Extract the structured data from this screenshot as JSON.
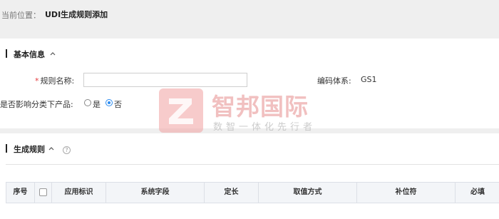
{
  "breadcrumb": {
    "prefix": "当前位置：",
    "title": "UDI生成规则添加"
  },
  "basic_info": {
    "title": "基本信息",
    "rule_name": {
      "required_mark": "*",
      "label": "规则名称:",
      "value": "",
      "placeholder": ""
    },
    "coding_system": {
      "label": "编码体系:",
      "value": "GS1"
    },
    "affects_products": {
      "label": "是否影响分类下产品:",
      "options": [
        "是",
        "否"
      ],
      "selected": "否"
    }
  },
  "generation_rules": {
    "title": "生成规则",
    "help_icon": "?",
    "table": {
      "columns": [
        "序号",
        "",
        "应用标识",
        "系统字段",
        "定长",
        "取值方式",
        "补位符",
        "必填"
      ]
    }
  },
  "watermark": {
    "logo_icon": "z-logo-icon",
    "name": "智邦国际",
    "slogan": "数智一体化先行者"
  },
  "colors": {
    "page_bg": "#efefef",
    "required": "#e4393c",
    "radio_selected": "#2d8cf0",
    "table_header_bg": "#f3f5f8",
    "watermark": "#f0a0a0"
  }
}
